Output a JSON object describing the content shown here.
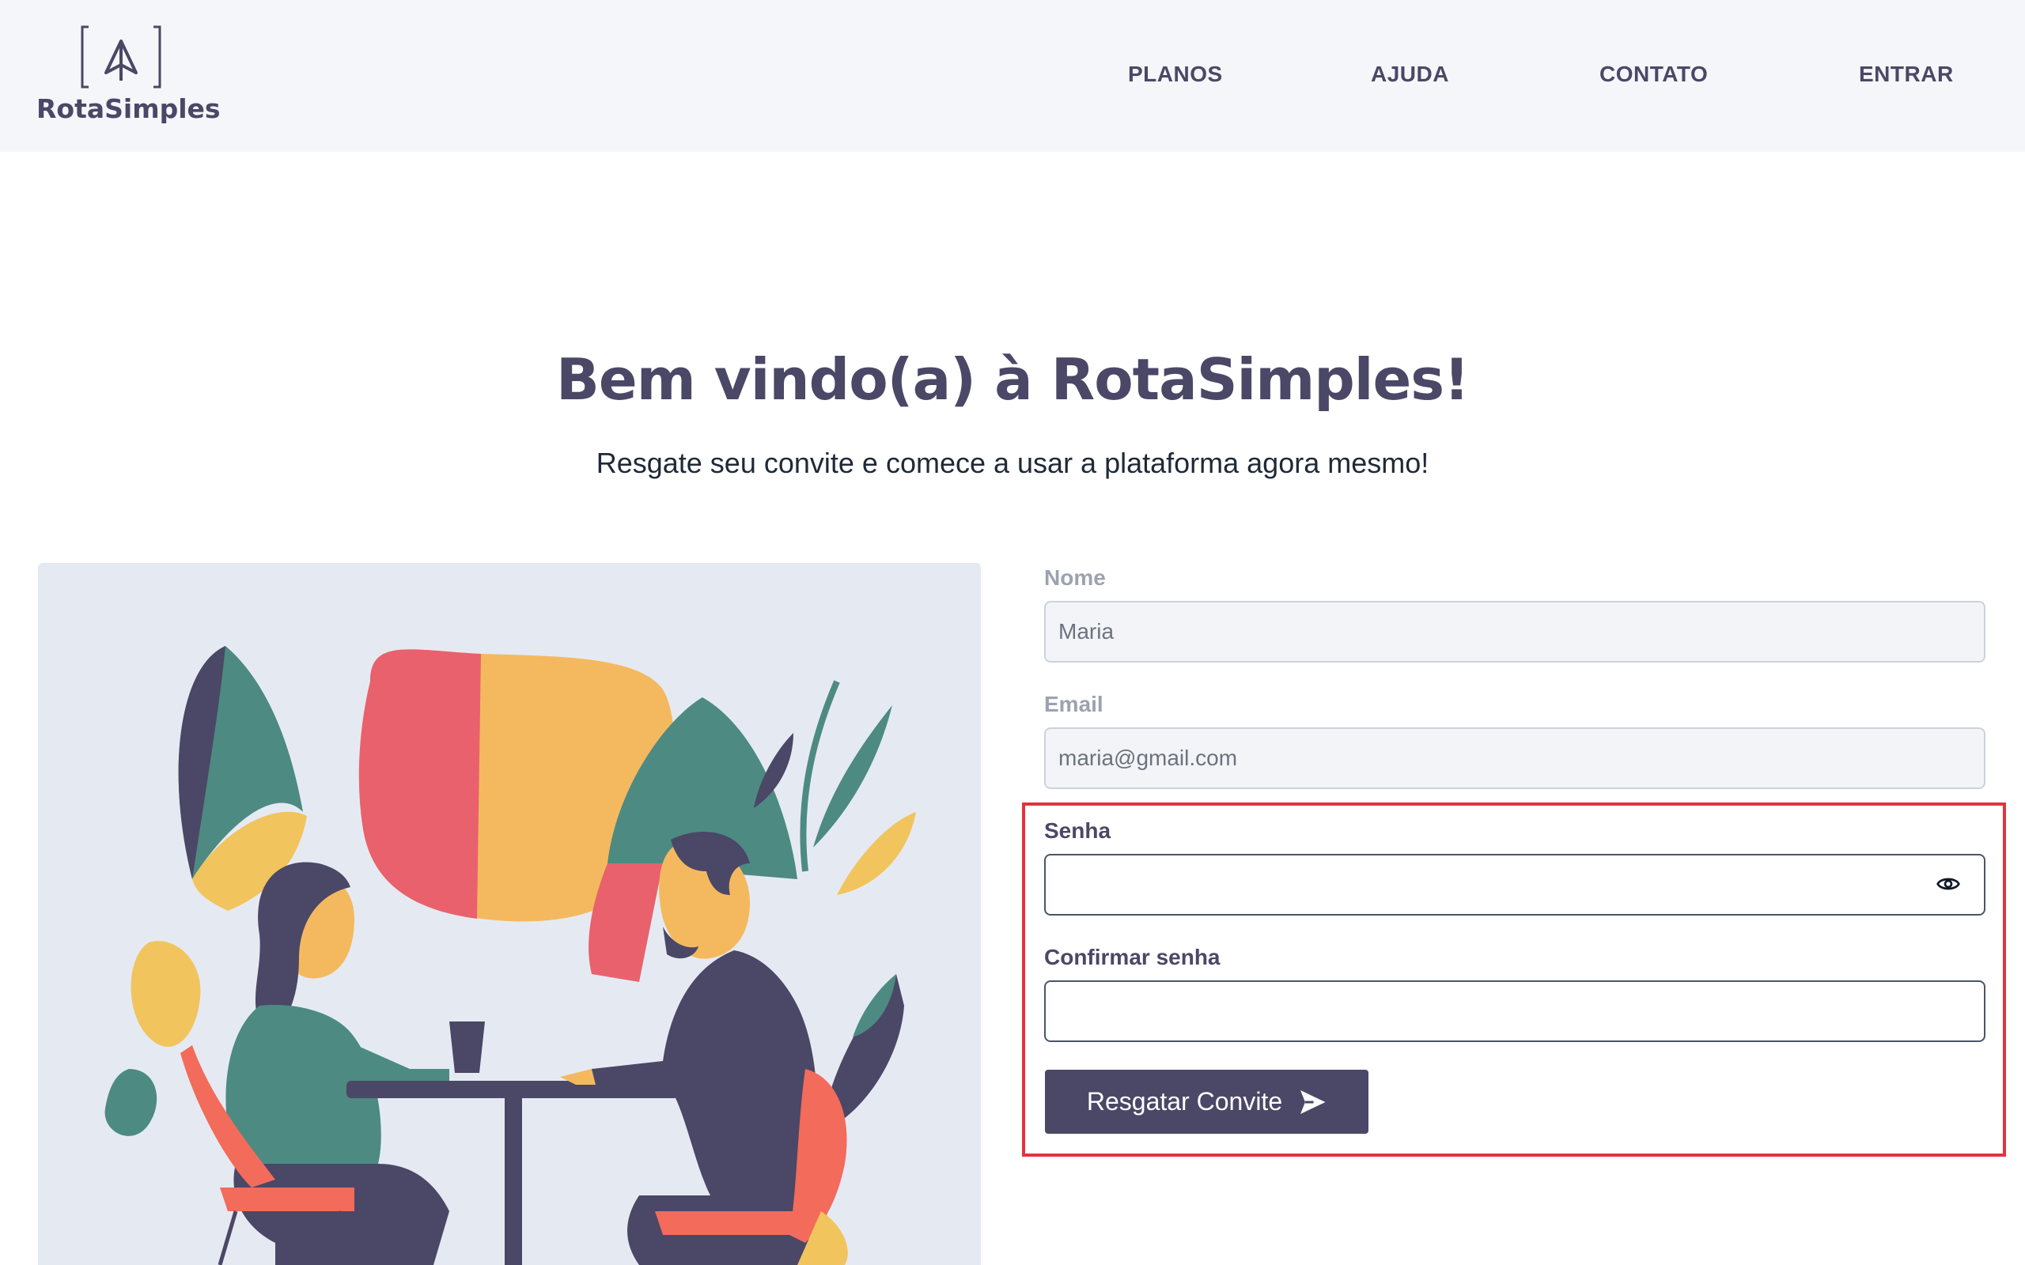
{
  "brand": {
    "name": "RotaSimples"
  },
  "nav": {
    "items": [
      "PLANOS",
      "AJUDA",
      "CONTATO",
      "ENTRAR"
    ]
  },
  "hero": {
    "title": "Bem vindo(a) à RotaSimples!",
    "subtitle": "Resgate seu convite e comece a usar a plataforma agora mesmo!"
  },
  "form": {
    "name": {
      "label": "Nome",
      "value": "Maria"
    },
    "email": {
      "label": "Email",
      "value": "maria@gmail.com"
    },
    "password": {
      "label": "Senha",
      "value": "",
      "icon": "eye-icon"
    },
    "confirm_password": {
      "label": "Confirmar senha",
      "value": ""
    },
    "submit": {
      "label": "Resgatar Convite",
      "icon": "send-icon"
    }
  },
  "colors": {
    "brand": "#4b4766",
    "header_bg": "#f5f6fa",
    "highlight": "#e5323e",
    "illustration_bg": "#e5eaf2"
  }
}
